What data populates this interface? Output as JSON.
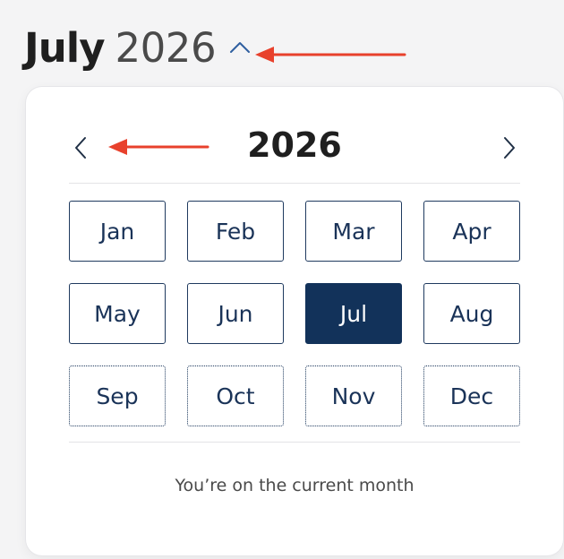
{
  "header": {
    "month": "July",
    "year": "2026"
  },
  "picker": {
    "year": "2026",
    "months": [
      {
        "label": "Jan",
        "state": "past"
      },
      {
        "label": "Feb",
        "state": "past"
      },
      {
        "label": "Mar",
        "state": "past"
      },
      {
        "label": "Apr",
        "state": "past"
      },
      {
        "label": "May",
        "state": "past"
      },
      {
        "label": "Jun",
        "state": "past"
      },
      {
        "label": "Jul",
        "state": "selected"
      },
      {
        "label": "Aug",
        "state": "past"
      },
      {
        "label": "Sep",
        "state": "future"
      },
      {
        "label": "Oct",
        "state": "future"
      },
      {
        "label": "Nov",
        "state": "future"
      },
      {
        "label": "Dec",
        "state": "future"
      }
    ],
    "status": "You’re on the current month"
  },
  "icons": {
    "toggle": "chevron-up-icon",
    "prev": "chevron-left-icon",
    "next": "chevron-right-icon"
  },
  "colors": {
    "selected_bg": "#12325a",
    "button_text": "#1a3358",
    "button_border": "#1f3a5f",
    "annotation_arrow": "#e8412c",
    "toggle_chevron": "#2f5fa0"
  }
}
